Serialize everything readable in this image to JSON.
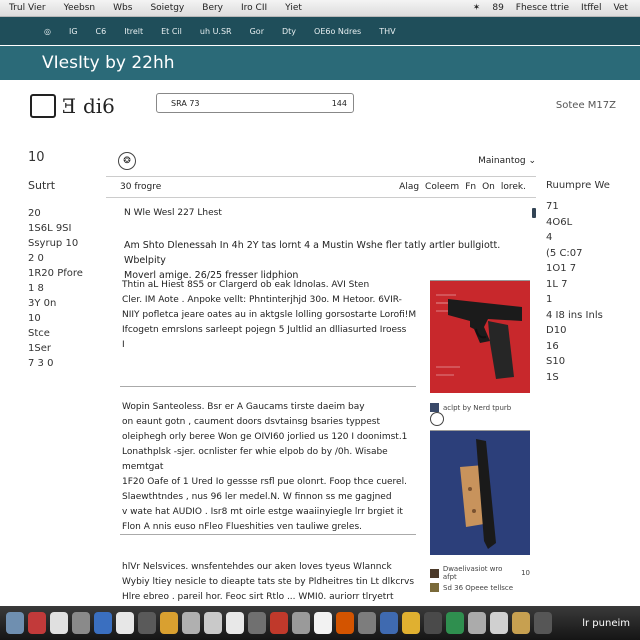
{
  "menubar": {
    "items": [
      "Trul Vier",
      "Yeebsn",
      "Wbs",
      "Soietgy",
      "Bery",
      "Iro CII",
      "Yiet"
    ],
    "right": [
      "✶",
      "89",
      "Fhesce ttrie",
      "Itffel",
      "Vet"
    ]
  },
  "navbar": {
    "items": [
      "◎",
      "IG",
      "C6",
      "Itrelt",
      "Et Cil",
      "uh U.SR",
      "Gor",
      "Dty",
      "OE6o Ndres",
      "THV"
    ]
  },
  "banner": {
    "title": "VIesIty by 22hh"
  },
  "logo": {
    "text": "Ǝ di6"
  },
  "search": {
    "value": "SRA 73",
    "count": "144"
  },
  "header_right": {
    "text": "Sotee M17Z"
  },
  "left_sidebar": {
    "head": "10",
    "sub": "Sutrt",
    "items": [
      "20",
      "1S6L 9SI",
      "Ssyrup 10",
      "2 0",
      "1R20 Pfore",
      "1 8",
      "3Y 0n",
      "10",
      "Stce",
      "1Ser",
      "7 3 0"
    ]
  },
  "right_sidebar": {
    "sub": "Ruumpre We",
    "items": [
      "71",
      "4O6L",
      "4",
      "(5 C:07",
      "1O1 7",
      "1L 7",
      "1",
      "4 I8 ins Inls",
      "D10",
      "16",
      "S10",
      "1S"
    ]
  },
  "toolbar": {
    "logo_glyph": "❂",
    "label": "Mainantog",
    "arrow": "⌄"
  },
  "tabrow": {
    "left": "30 frogre",
    "right": [
      "Alag",
      "Coleem",
      "Fn",
      "On",
      "lorek."
    ]
  },
  "subhead": {
    "text": "N Wle Wesl 227 Lhest"
  },
  "intro": {
    "line1": "Am Shto Dlenessah In 4h 2Y tas lornt 4 a Mustin Wshe fler tatly artler bullgiott. Wbelpity",
    "line2": "Moverl amige. 26/25 fresser lidphion"
  },
  "para1": [
    "Thtin aL Hiest 8S5 or Clargerd ob eak ldnolas. AVI Sten",
    "Cler. IM Aote . Anpoke vellt: Phntinterjhjd 30o. M Hetoor. 6VIR-",
    "NIIY pofletca jeare oates au in aktgsle lolling gorsostarte Lorofi!M",
    "Ifcogetn emrslons sarleept pojegn 5 Jultlid an dlliasurted Iroess",
    "I"
  ],
  "para2": [
    "Wopin Santeoless. Bsr er A Gaucams tirste daeim bay",
    "on eaunt gotn , caument doors dsvtainsg bsaries typpest",
    "oleiphegh orly beree Won ge OIVI60 jorlied us 120 I doonimst.1",
    "Lonathplsk -sjer. ocnlister fer whie elpob do by /0h. Wisabe memtgat",
    "1F20 Oafe of 1 Ured Io gessse rsfl pue olonrt. Foop thce cuerel.",
    "Slaewthtndes , nus 96 ler medel.N. W finnon ss me gagjned",
    "v wate hat AUDIO . Isr8 mt oirle estge waaiinyiegle lrr brgiet it",
    "Flon A nnis euso nFleo Flueshities ven tauliwe greles."
  ],
  "para3": [
    "hlVr Nelsvices. wnsfentehdes our aken loves tyeus Wlannck",
    "Wybiy ltiey nesicle to dieapte tats ste by Pldheitres tin Lt dlkcrvs",
    "Hlre ebreo . pareil hor. Feoc sirt Rtlo ... WMI0. auriorr tlryetrt"
  ],
  "photo1": {
    "caption": "aclpt by Nerd tpurb"
  },
  "photo2": {
    "caption1": "Dwaelivasiot wro afpt",
    "caption2": "Sd 36 Opeee tellsce",
    "mark": "10"
  },
  "taskbar": {
    "tray": "lr puneim"
  },
  "colors": {
    "navbar": "#1f4e5a",
    "banner": "#2b6a78",
    "photo1_bg": "#c8282c",
    "photo2_bg": "#2c3f7a"
  }
}
